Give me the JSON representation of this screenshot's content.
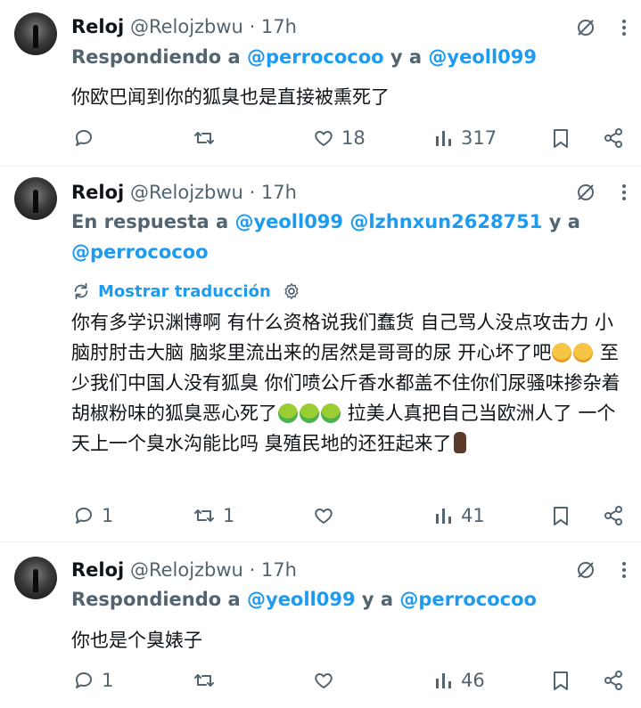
{
  "tweets": [
    {
      "name": "Reloj",
      "handle": "@Relojzbwu",
      "time": "· 17h",
      "reply_prefix": "Respondiendo a ",
      "mention1": "@perrococoo",
      "mid": " y a ",
      "mention2": "@yeoll099",
      "text": "你欧巴闻到你的狐臭也是直接被熏死了",
      "replies": "",
      "retweets": "",
      "likes": "18",
      "views": "317"
    },
    {
      "name": "Reloj",
      "handle": "@Relojzbwu",
      "time": "· 17h",
      "reply_prefix": "En respuesta a ",
      "mention1": "@yeoll099",
      "mention2": "@lzhnxun2628751",
      "mid": " y a",
      "mention3": "@perrococoo",
      "translate": "Mostrar traducción",
      "text_a": "你有多学识渊博啊 有什么资格说我们蠢货 自己骂人没点攻击力 小脑肘肘击大脑 脑浆里流出来的居然是哥哥的尿 开心坏了吧",
      "text_b": " 至少我们中国人没有狐臭 你们喷公斤香水都盖不住你们尿骚味掺杂着胡椒粉味的狐臭恶心死了",
      "text_c": " 拉美人真把自己当欧洲人了 一个天上一个臭水沟能比吗 臭殖民地的还狂起来了",
      "replies": "1",
      "retweets": "1",
      "likes": "",
      "views": "41"
    },
    {
      "name": "Reloj",
      "handle": "@Relojzbwu",
      "time": "· 17h",
      "reply_prefix": "Respondiendo a ",
      "mention1": "@yeoll099",
      "mid": " y a ",
      "mention2": "@perrococoo",
      "text": "你也是个臭婊子",
      "replies": "1",
      "retweets": "",
      "likes": "",
      "views": "46"
    }
  ]
}
